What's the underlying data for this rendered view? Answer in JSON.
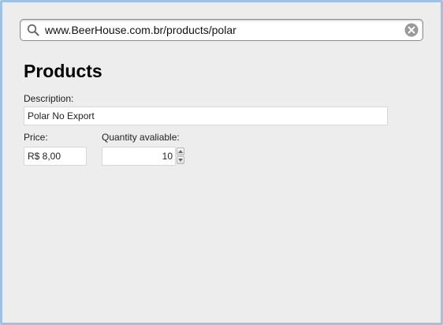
{
  "browser": {
    "url": "www.BeerHouse.com.br/products/polar",
    "search_icon": "search-icon",
    "clear_icon": "clear-icon"
  },
  "page": {
    "title": "Products"
  },
  "form": {
    "description_label": "Description:",
    "description_value": "Polar No Export",
    "price_label": "Price:",
    "price_value": "R$ 8,00",
    "quantity_label": "Quantity avaliable:",
    "quantity_value": "10"
  },
  "colors": {
    "window_border": "#9cc2e6",
    "page_background": "#ededed"
  }
}
